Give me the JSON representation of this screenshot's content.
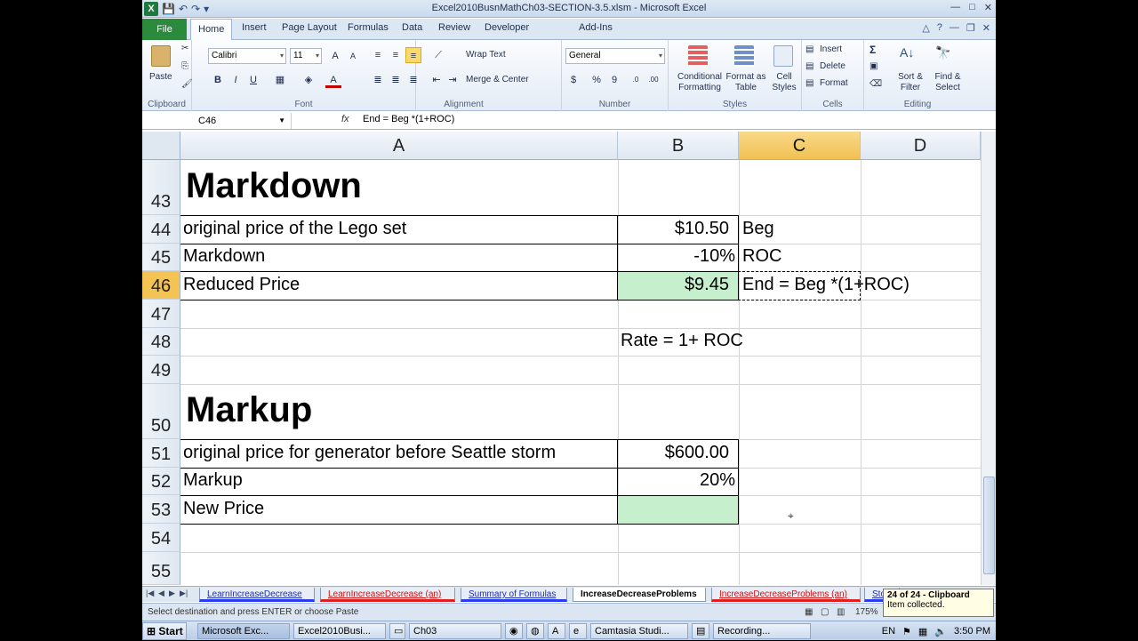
{
  "window": {
    "title": "Excel2010BusnMathCh03-SECTION-3.5.xlsm  -  Microsoft Excel",
    "excel_logo": "X",
    "qat": [
      "💾",
      "↶",
      "↷",
      "▾"
    ],
    "controls": [
      "—",
      "□",
      "✕"
    ]
  },
  "ribbon_tabs": [
    "File",
    "Home",
    "Insert",
    "Page Layout",
    "Formulas",
    "Data",
    "Review",
    "Developer",
    "Add-Ins"
  ],
  "ribbon_tabs_active": "Home",
  "ribbon": {
    "paste": "Paste",
    "font_name": "Calibri",
    "font_size": "11",
    "bold": "B",
    "italic": "I",
    "underline": "U",
    "wrap_text": "Wrap Text",
    "merge_center": "Merge & Center",
    "number_format": "General",
    "currency": "$",
    "percent": "%",
    "comma": "9",
    "conditional_formatting": [
      "Conditional",
      "Formatting"
    ],
    "format_as_table": [
      "Format as",
      "Table"
    ],
    "cell_styles": [
      "Cell",
      "Styles"
    ],
    "insert": "Insert",
    "delete": "Delete",
    "format": "Format",
    "sort_filter": [
      "Sort &",
      "Filter"
    ],
    "find_select": [
      "Find &",
      "Select"
    ],
    "groups": [
      "Clipboard",
      "Font",
      "Alignment",
      "Number",
      "Styles",
      "Cells",
      "Editing"
    ]
  },
  "formula_bar": {
    "name_box": "C46",
    "fx": "fx",
    "formula": "End = Beg *(1+ROC)"
  },
  "columns": [
    "A",
    "B",
    "C",
    "D"
  ],
  "selected_column": "C",
  "rows": [
    {
      "num": "43",
      "a": "Markdown",
      "b": "",
      "c": ""
    },
    {
      "num": "44",
      "a": "original price of the Lego set",
      "b": "$10.50",
      "c": "Beg"
    },
    {
      "num": "45",
      "a": "Markdown",
      "b": "-10%",
      "c": "ROC"
    },
    {
      "num": "46",
      "a": "Reduced Price",
      "b": "$9.45",
      "c": "End = Beg *(1+ROC)"
    },
    {
      "num": "47",
      "a": "",
      "b": "",
      "c": ""
    },
    {
      "num": "48",
      "a": "",
      "b": "Rate = 1+ ROC",
      "c": ""
    },
    {
      "num": "49",
      "a": "",
      "b": "",
      "c": ""
    },
    {
      "num": "50",
      "a": "Markup",
      "b": "",
      "c": ""
    },
    {
      "num": "51",
      "a": "original price for generator before Seattle storm",
      "b": "$600.00",
      "c": ""
    },
    {
      "num": "52",
      "a": "Markup",
      "b": "20%",
      "c": ""
    },
    {
      "num": "53",
      "a": "New Price",
      "b": "",
      "c": ""
    },
    {
      "num": "54",
      "a": "",
      "b": "",
      "c": ""
    },
    {
      "num": "55",
      "a": "",
      "b": "",
      "c": ""
    }
  ],
  "selected_row": "46",
  "sheet_tabs": [
    {
      "label": "LearnIncreaseDecrease",
      "style": "blue"
    },
    {
      "label": "LearnIncreaseDecrease (an)",
      "style": "red"
    },
    {
      "label": "Summary of Formulas",
      "style": "blue"
    },
    {
      "label": "IncreaseDecreaseProblems",
      "style": "active"
    },
    {
      "label": "IncreaseDecreaseProblems (an)",
      "style": "red"
    },
    {
      "label": "Stoc",
      "style": "blue"
    }
  ],
  "status": {
    "message": "Select destination and press ENTER or choose Paste",
    "zoom": "175%"
  },
  "clipboard_popup": {
    "title": "24 of 24 - Clipboard",
    "text": "Item collected."
  },
  "taskbar": {
    "start": "Start",
    "items": [
      "Microsoft Exc...",
      "Excel2010Busi...",
      "Ch03",
      "Camtasia Studi...",
      "Recording..."
    ],
    "lang": "EN",
    "clock": "3:50 PM"
  }
}
